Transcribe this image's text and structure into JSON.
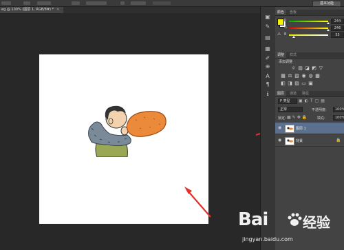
{
  "option_bar": {
    "preset_label": "基本功能"
  },
  "document_tab": {
    "title": "eg @ 100% (图层 1, RGB/8#) *",
    "close": "×"
  },
  "color_panel": {
    "tabs": [
      "颜色",
      "色板"
    ],
    "foreground": "#f4f200",
    "background": "#ffffff",
    "sliders": [
      {
        "label": "R",
        "value": "244",
        "fraction": 0.957,
        "color": "#d44"
      },
      {
        "label": "G",
        "value": "246",
        "fraction": 0.965,
        "color": "#4c4"
      },
      {
        "label": "B",
        "value": "55",
        "fraction": 0.216,
        "color": "#44d"
      }
    ]
  },
  "adjust_panel": {
    "tabs": [
      "调整",
      "样式"
    ],
    "heading": "添加调整",
    "row1_icons": [
      "brightness-icon",
      "levels-icon",
      "curves-icon",
      "exposure-icon"
    ],
    "row2_icons": [
      "vibrance-icon",
      "hue-sat-icon",
      "color-balance-icon",
      "bw-icon",
      "photo-filter-icon",
      "channel-mixer-icon",
      "color-lookup-icon"
    ],
    "row3_icons": [
      "invert-icon",
      "posterize-icon",
      "threshold-icon",
      "gradient-map-icon",
      "selective-color-icon"
    ]
  },
  "layers_panel": {
    "tabs": [
      "图层",
      "通道",
      "路径"
    ],
    "filter_kind": "P 类型",
    "blend_mode": "正常",
    "opacity_label": "不透明度:",
    "opacity_value": "100%",
    "lock_label": "锁定:",
    "fill_label": "填充:",
    "fill_value": "100%",
    "layers": [
      {
        "name": "图层 1",
        "selected": true
      },
      {
        "name": "背景",
        "selected": false
      }
    ]
  },
  "watermark": {
    "brand": "Bai",
    "brand2": "经验",
    "url": "jingyan.baidu.com"
  },
  "accent_arrow_color": "#e0302a"
}
